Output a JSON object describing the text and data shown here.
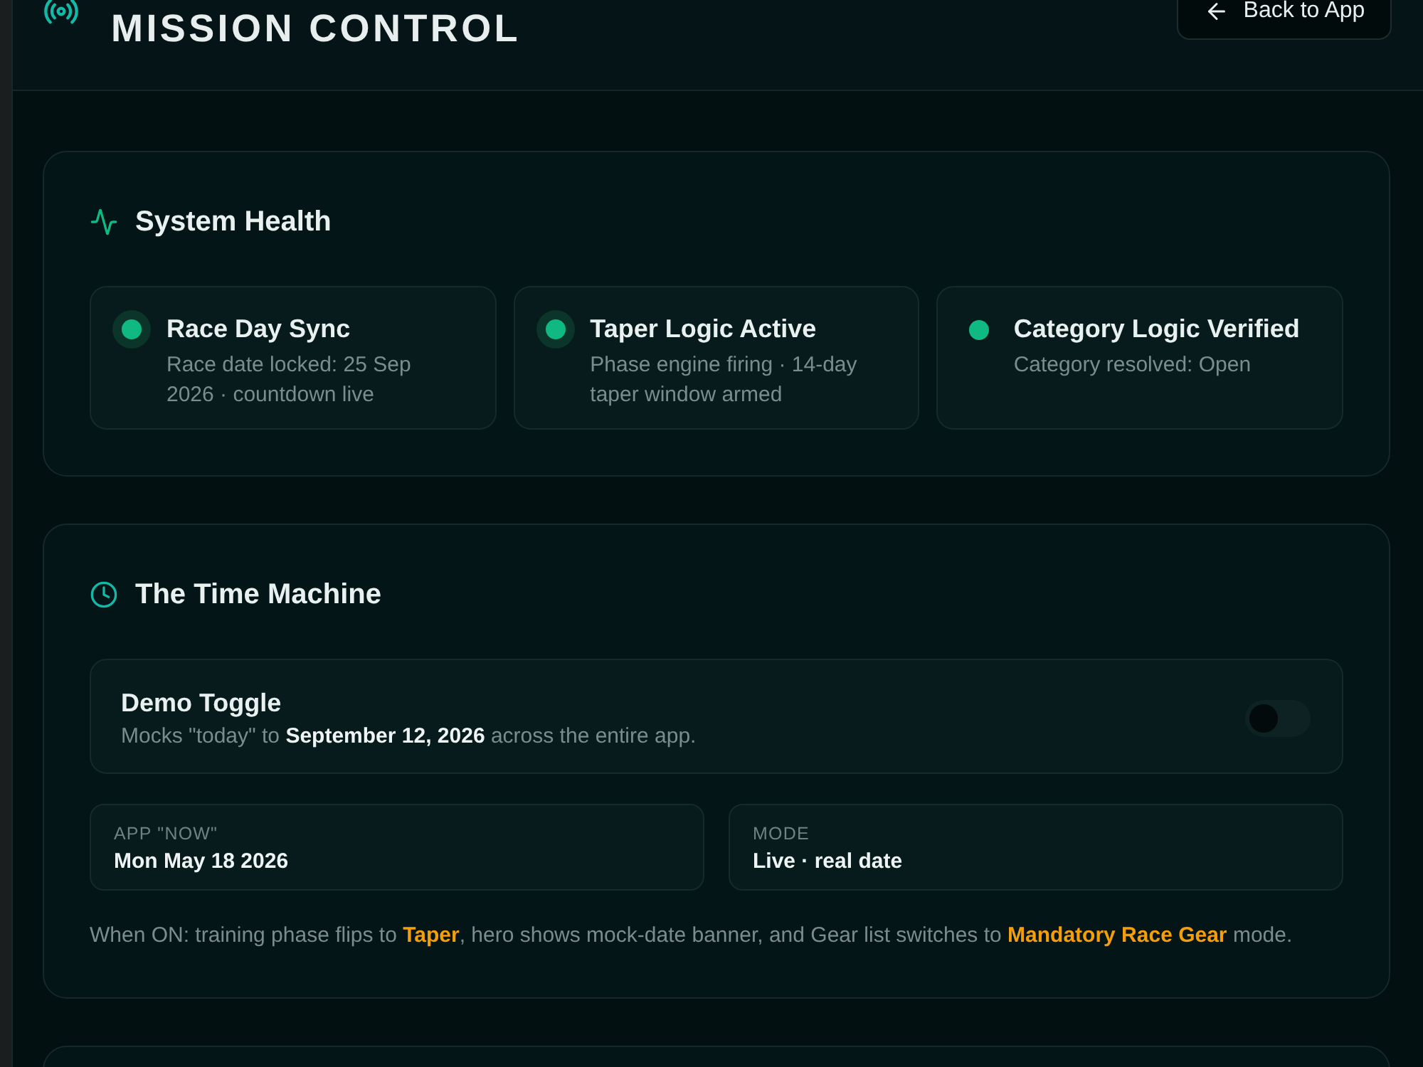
{
  "header": {
    "title": "MISSION CONTROL",
    "back_button": {
      "label": "Back to App"
    }
  },
  "system_health": {
    "title": "System Health",
    "checks": [
      {
        "title": "Race Day Sync",
        "detail": "Race date locked: 25 Sep 2026 · countdown live",
        "glow": true
      },
      {
        "title": "Taper Logic Active",
        "detail": "Phase engine firing · 14-day taper window armed",
        "glow": true
      },
      {
        "title": "Category Logic Verified",
        "detail": "Category resolved: Open",
        "glow": false
      }
    ]
  },
  "time_machine": {
    "title": "The Time Machine",
    "demo_toggle": {
      "label": "Demo Toggle",
      "description": "Mocks \"today\" to **September 12, 2026** across the entire app.",
      "on": false
    },
    "readouts": [
      {
        "label": "APP \"NOW\"",
        "value": "Mon May 18 2026"
      },
      {
        "label": "MODE",
        "value": "Live · real date"
      }
    ],
    "note": "When ON: training phase flips to **Taper**, hero shows mock-date banner, and Gear list switches to **Mandatory Race Gear** mode."
  }
}
